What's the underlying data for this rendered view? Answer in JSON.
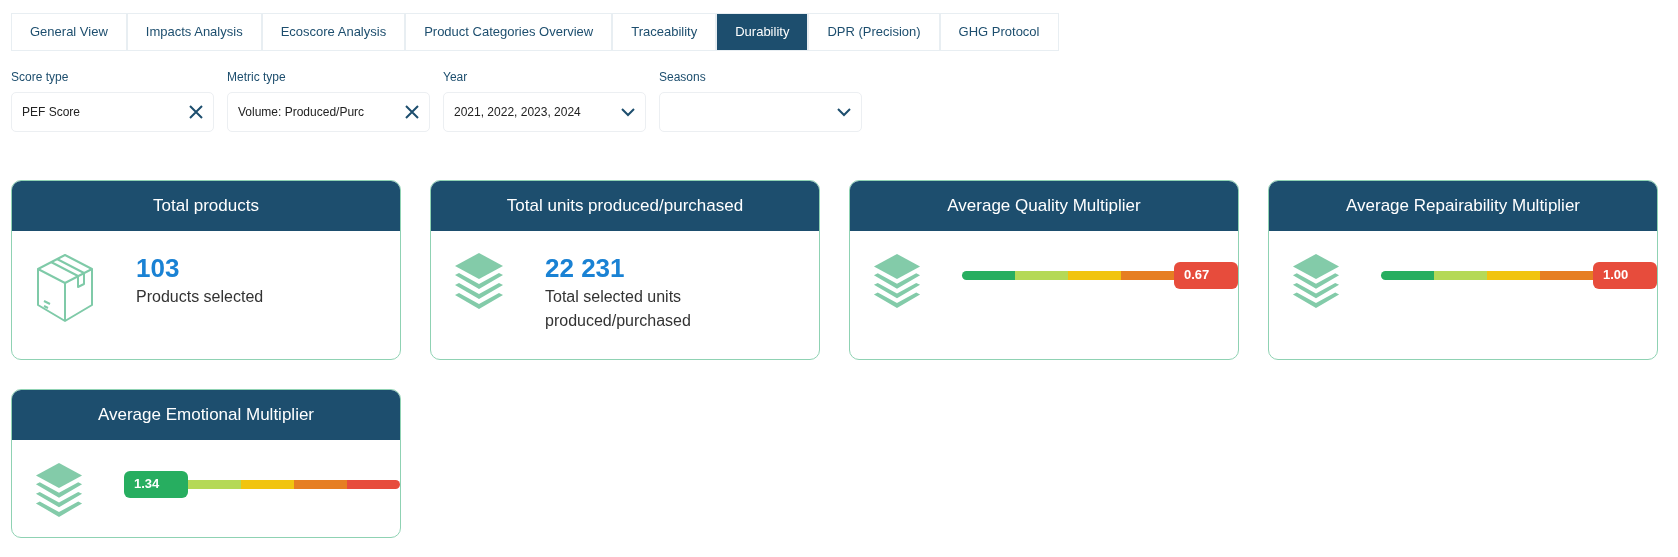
{
  "tabs": [
    {
      "label": "General View",
      "selected": false
    },
    {
      "label": "Impacts Analysis",
      "selected": false
    },
    {
      "label": "Ecoscore Analysis",
      "selected": false
    },
    {
      "label": "Product Categories Overview",
      "selected": false
    },
    {
      "label": "Traceability",
      "selected": false
    },
    {
      "label": "Durability",
      "selected": true
    },
    {
      "label": "DPR (Precision)",
      "selected": false
    },
    {
      "label": "GHG Protocol",
      "selected": false
    }
  ],
  "filters": [
    {
      "label": "Score type",
      "value": "PEF Score",
      "kind": "clearable"
    },
    {
      "label": "Metric type",
      "value": "Volume: Produced/Purc",
      "kind": "clearable"
    },
    {
      "label": "Year",
      "value": "2021, 2022, 2023, 2024",
      "kind": "dropdown"
    },
    {
      "label": "Seasons",
      "kind": "dropdown"
    }
  ],
  "cards": [
    {
      "kind": "product_count",
      "title": "Total products",
      "value": "103",
      "caption": "Products selected"
    },
    {
      "kind": "unit_count",
      "title": "Total units produced/purchased",
      "value": "22 231",
      "caption": "Total selected units produced/purchased"
    },
    {
      "kind": "gauge",
      "title": "Average Quality Multiplier",
      "reading": "0.67",
      "segments": [
        {
          "color": "#27ae60",
          "selected": false
        },
        {
          "color": "#b5d957",
          "selected": false
        },
        {
          "color": "#f1c40f",
          "selected": false
        },
        {
          "color": "#e67e22",
          "selected": false
        },
        {
          "color": "#e74c3c",
          "selected": true
        }
      ]
    },
    {
      "kind": "gauge",
      "title": "Average Repairability Multiplier",
      "reading": "1.00",
      "segments": [
        {
          "color": "#27ae60",
          "selected": false
        },
        {
          "color": "#b5d957",
          "selected": false
        },
        {
          "color": "#f1c40f",
          "selected": false
        },
        {
          "color": "#e67e22",
          "selected": false
        },
        {
          "color": "#e74c3c",
          "selected": true
        }
      ]
    },
    {
      "kind": "gauge",
      "title": "Average Emotional Multiplier",
      "reading": "1.34",
      "segments": [
        {
          "color": "#27ae60",
          "selected": true
        },
        {
          "color": "#b5d957",
          "selected": false
        },
        {
          "color": "#f1c40f",
          "selected": false
        },
        {
          "color": "#e67e22",
          "selected": false
        },
        {
          "color": "#e74c3c",
          "selected": false
        }
      ]
    }
  ]
}
